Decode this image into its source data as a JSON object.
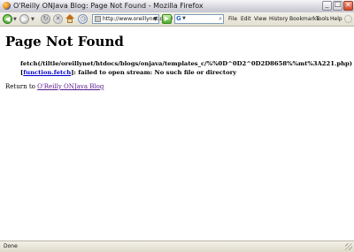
{
  "window": {
    "title": "O'Reilly ONJava Blog: Page Not Found - Mozilla Firefox",
    "minimize": "_",
    "maximize": "□",
    "close": "✕"
  },
  "toolbar": {
    "url": "http://www.oreillynet.com/",
    "menus": [
      "File",
      "Edit",
      "View",
      "History",
      "Bookmarks",
      "Tools",
      "Help"
    ]
  },
  "page": {
    "heading": "Page Not Found",
    "error_prefix": "fetch(/tiltle/oreillynet/htdocs/blogs/onjava/templates_c/%%0D^0D2^0D2D8658%%mt%3A221.php) [",
    "error_link": "function.fetch",
    "error_suffix": "]: failed to open stream: No such file or directory",
    "return_prefix": "Return to ",
    "return_link": "O'Reilly ONJava Blog"
  },
  "status": {
    "text": "Done"
  }
}
